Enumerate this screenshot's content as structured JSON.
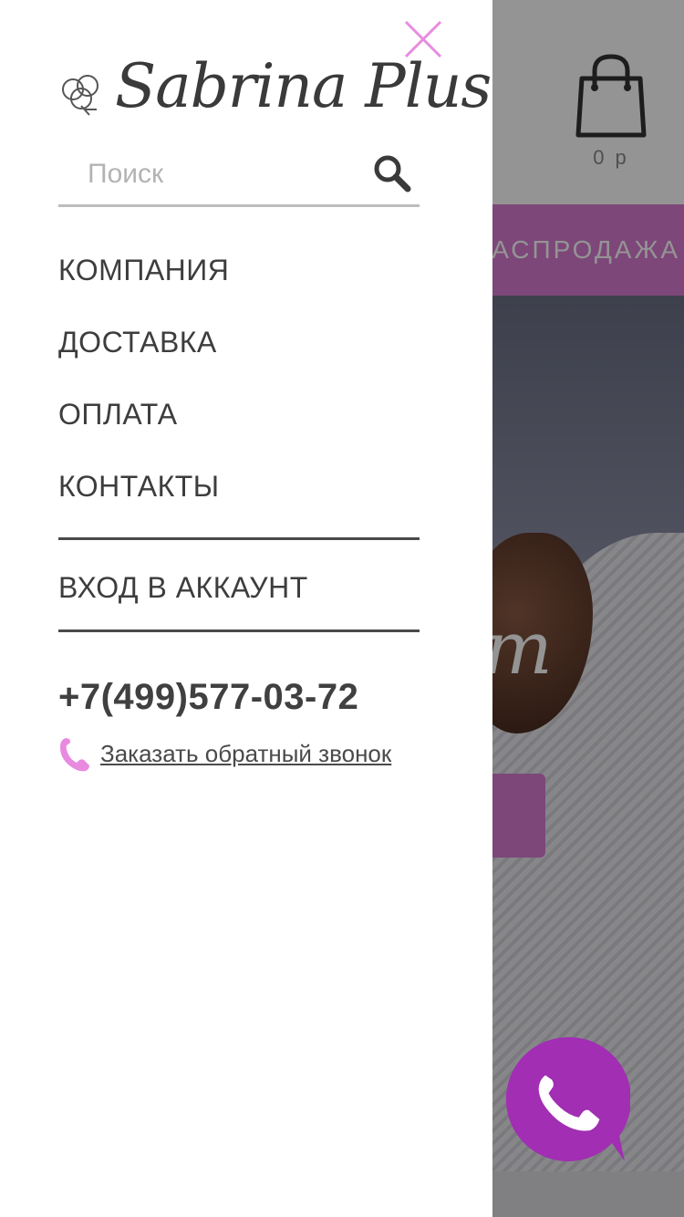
{
  "drawer": {
    "logo_text": "Sabrina Plus",
    "search": {
      "placeholder": "Поиск"
    },
    "menu": [
      {
        "label": "КОМПАНИЯ"
      },
      {
        "label": "ДОСТАВКА"
      },
      {
        "label": "ОПЛАТА"
      },
      {
        "label": "КОНТАКТЫ"
      }
    ],
    "account_label": "ВХОД В АККАУНТ",
    "phone": "+7(499)577-03-72",
    "callback_label": "Заказать обратный звонок",
    "icons": {
      "close": "close-icon",
      "logo": "cotton-flower-icon",
      "search": "search-icon",
      "callback": "phone-handset-icon"
    }
  },
  "background": {
    "cart_total": "0 р",
    "sale_label": "РАСПРОДАЖА",
    "hero_script": "m"
  },
  "colors": {
    "accent_pink": "#e88be0",
    "sale_bar": "#d77bd0",
    "fab_purple": "#a12eb3",
    "text_dark": "#3d3d3d"
  }
}
